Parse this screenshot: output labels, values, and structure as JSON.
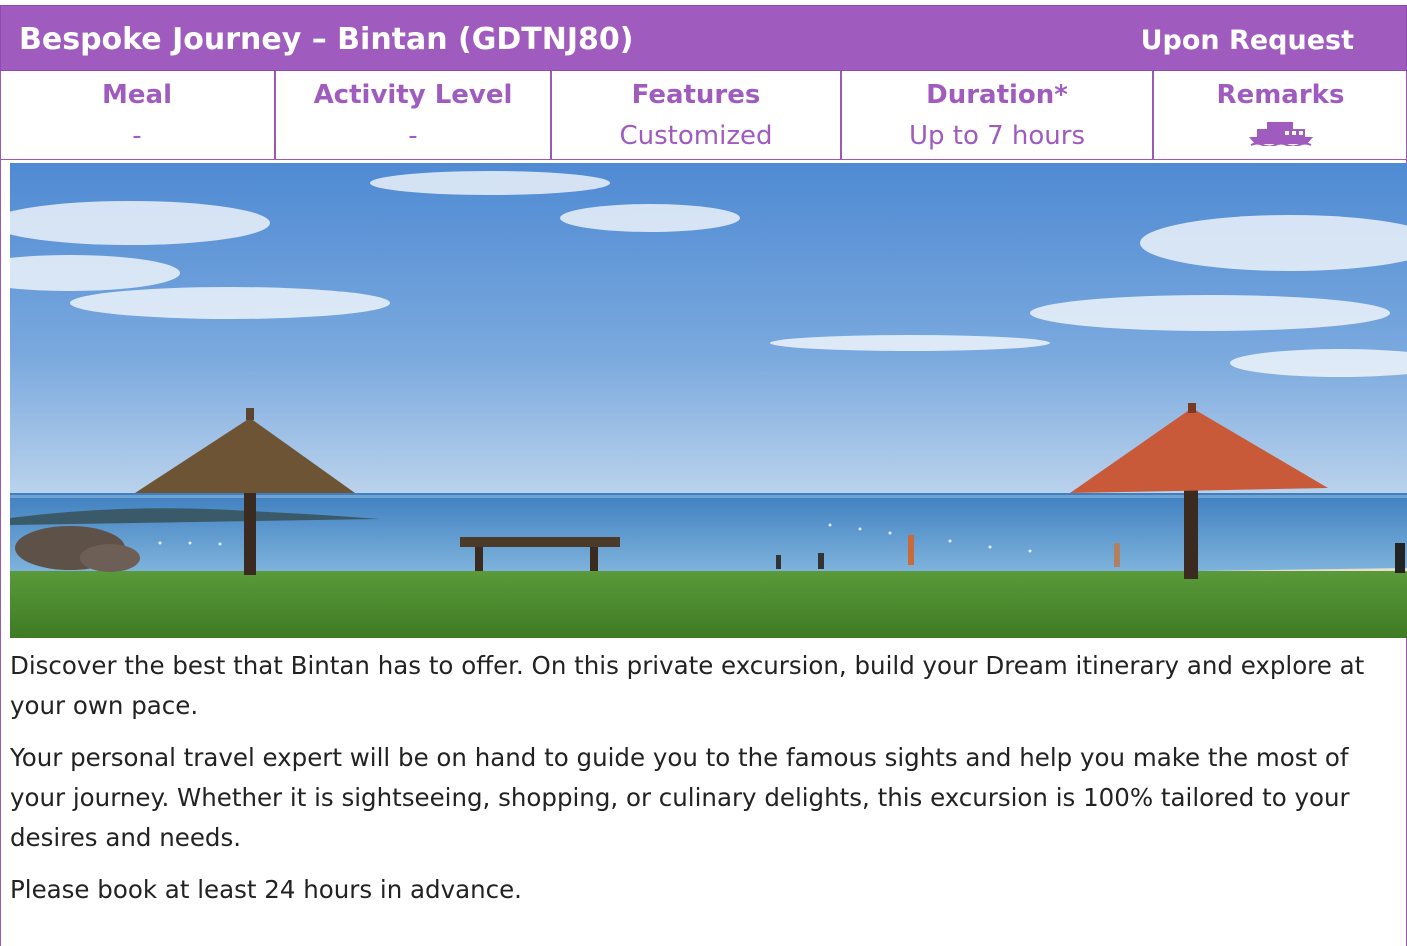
{
  "header": {
    "title": "Bespoke Journey – Bintan (GDTNJ80)",
    "status": "Upon Request"
  },
  "info": [
    {
      "label": "Meal",
      "value": "-"
    },
    {
      "label": "Activity Level",
      "value": "-"
    },
    {
      "label": "Features",
      "value": "Customized"
    },
    {
      "label": "Duration*",
      "value": "Up to 7 hours"
    },
    {
      "label": "Remarks",
      "icon": "ferry-icon"
    }
  ],
  "colors": {
    "accent": "#a05bbf"
  },
  "description": {
    "p1": "Discover the best that Bintan has to offer. On this private excursion, build your Dream itinerary and explore at your own pace.",
    "p2": "Your personal travel expert will be on hand to guide you to the famous sights and help you make the most of your journey. Whether it is sightseeing, shopping, or culinary delights, this excursion is 100% tailored to your desires and needs.",
    "p3": "Please book at least 24 hours in advance."
  }
}
